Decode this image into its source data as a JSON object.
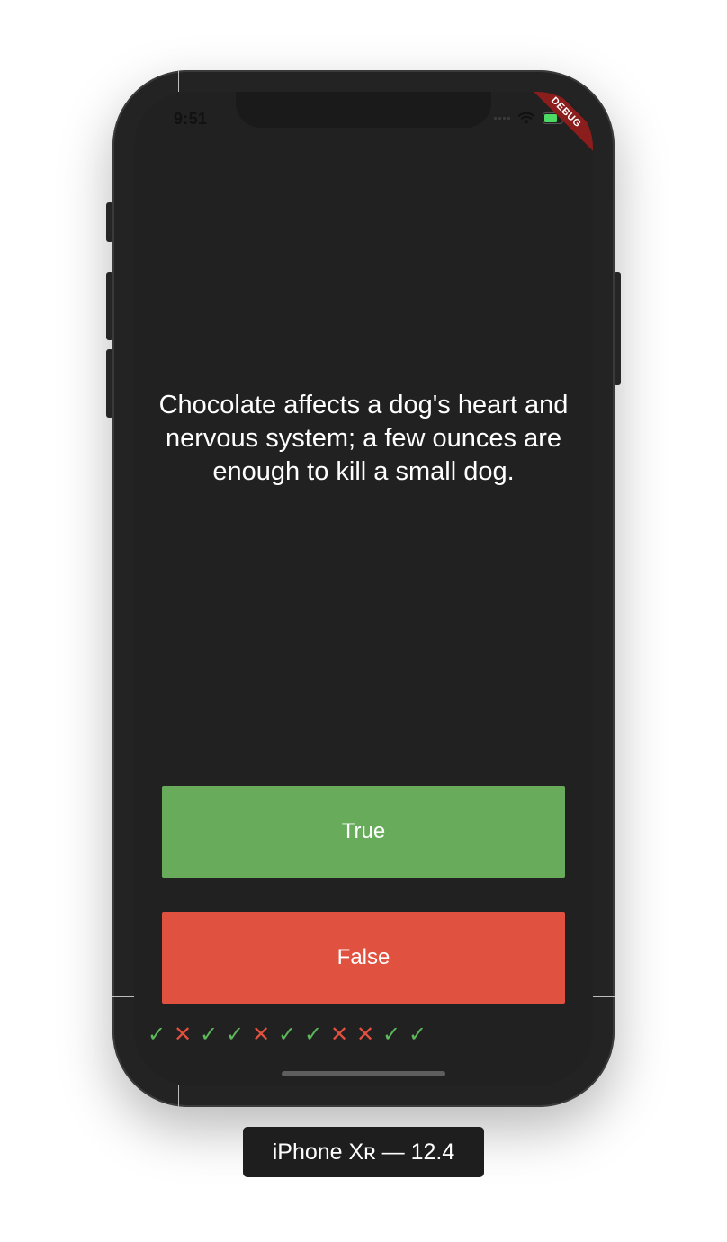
{
  "status_bar": {
    "time": "9:51",
    "debug_banner": "DEBUG"
  },
  "quiz": {
    "question": "Chocolate affects a dog's heart and nervous system; a few ounces are enough to kill a small dog.",
    "true_label": "True",
    "false_label": "False"
  },
  "score_keeper": {
    "marks": [
      "✓",
      "✕",
      "✓",
      "✓",
      "✕",
      "✓",
      "✓",
      "✕",
      "✕",
      "✓",
      "✓"
    ],
    "correct_color": "#5db85b",
    "wrong_color": "#e2513f"
  },
  "device": {
    "label": "iPhone Xʀ — 12.4"
  },
  "colors": {
    "true_button": "#67ab5b",
    "false_button": "#e05140",
    "screen_background": "#212121"
  }
}
